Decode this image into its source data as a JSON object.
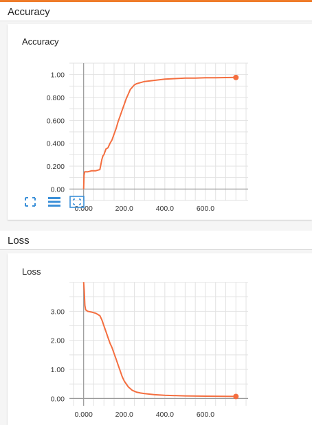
{
  "sections": [
    {
      "header": "Accuracy",
      "card_title": "Accuracy",
      "controls": [
        {
          "name": "fit-domain-icon",
          "glyph": "fullscreen"
        },
        {
          "name": "toggle-log-scale-icon",
          "glyph": "list"
        },
        {
          "name": "toggle-y-axis-fit-icon",
          "glyph": "fit"
        }
      ]
    },
    {
      "header": "Loss",
      "card_title": "Loss"
    }
  ],
  "colors": {
    "line": "#f46e3f",
    "accent": "#ef7c2a",
    "axis": "#999999",
    "grid": "#e2e2e2",
    "control": "#3a8fd8"
  },
  "chart_data": [
    {
      "type": "line",
      "title": "Accuracy",
      "xlabel": "",
      "ylabel": "",
      "xlim": [
        -70,
        810
      ],
      "ylim": [
        -0.1,
        1.1
      ],
      "x_ticks": [
        0,
        200,
        400,
        600
      ],
      "x_tick_labels": [
        "0.000",
        "200.0",
        "400.0",
        "600.0"
      ],
      "y_ticks": [
        0,
        0.2,
        0.4,
        0.6,
        0.8,
        1.0
      ],
      "y_tick_labels": [
        "0.00",
        "0.200",
        "0.400",
        "0.600",
        "0.800",
        "1.00"
      ],
      "grid": true,
      "series": [
        {
          "x": [
            0,
            2,
            5,
            20,
            40,
            60,
            80,
            90,
            95,
            100,
            110,
            120,
            130,
            140,
            150,
            160,
            170,
            180,
            190,
            200,
            210,
            220,
            230,
            240,
            250,
            260,
            280,
            300,
            350,
            400,
            450,
            500,
            550,
            600,
            650,
            700,
            750
          ],
          "y": [
            0.0,
            0.12,
            0.15,
            0.15,
            0.16,
            0.16,
            0.17,
            0.26,
            0.29,
            0.3,
            0.35,
            0.36,
            0.4,
            0.43,
            0.48,
            0.53,
            0.59,
            0.64,
            0.69,
            0.74,
            0.79,
            0.83,
            0.87,
            0.89,
            0.91,
            0.92,
            0.93,
            0.94,
            0.95,
            0.96,
            0.965,
            0.97,
            0.97,
            0.972,
            0.973,
            0.974,
            0.975
          ]
        }
      ]
    },
    {
      "type": "line",
      "title": "Loss",
      "xlabel": "",
      "ylabel": "",
      "xlim": [
        -70,
        810
      ],
      "ylim": [
        -0.25,
        4.0
      ],
      "x_ticks": [
        0,
        200,
        400,
        600
      ],
      "x_tick_labels": [
        "0.000",
        "200.0",
        "400.0",
        "600.0"
      ],
      "y_ticks": [
        0,
        1,
        2,
        3
      ],
      "y_tick_labels": [
        "0.00",
        "1.00",
        "2.00",
        "3.00"
      ],
      "grid": true,
      "series": [
        {
          "x": [
            0,
            3,
            6,
            10,
            20,
            40,
            60,
            80,
            90,
            100,
            110,
            120,
            130,
            140,
            150,
            160,
            170,
            180,
            190,
            200,
            220,
            240,
            260,
            280,
            300,
            350,
            400,
            500,
            600,
            700,
            750
          ],
          "y": [
            4.0,
            3.7,
            3.2,
            3.05,
            3.0,
            2.97,
            2.93,
            2.85,
            2.7,
            2.5,
            2.3,
            2.1,
            1.9,
            1.75,
            1.55,
            1.35,
            1.15,
            0.95,
            0.75,
            0.6,
            0.4,
            0.28,
            0.22,
            0.19,
            0.17,
            0.13,
            0.11,
            0.09,
            0.08,
            0.075,
            0.07
          ]
        }
      ]
    }
  ]
}
